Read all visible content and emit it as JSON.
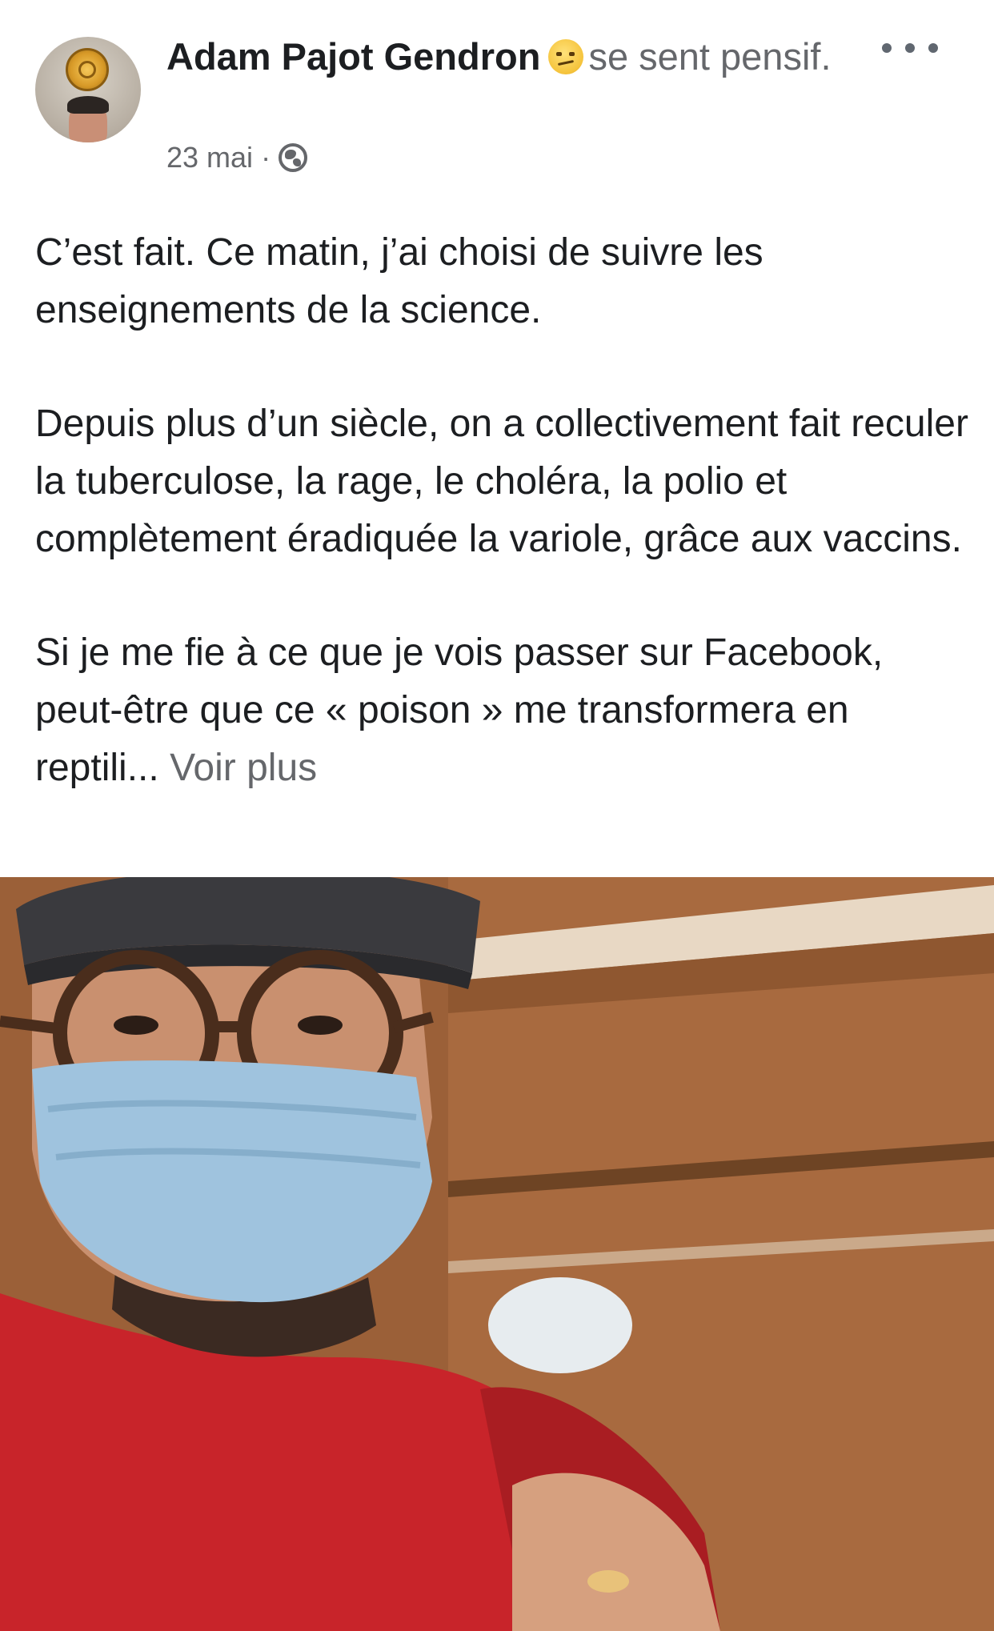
{
  "post": {
    "author": {
      "name": "Adam Pajot Gendron",
      "feeling_emoji": "pensive-face-icon",
      "feeling_text": "se sent pensif."
    },
    "meta": {
      "date": "23 mai",
      "separator": "·",
      "privacy_icon": "globe-icon"
    },
    "menu_icon": "more-options-icon",
    "paragraphs": [
      "C’est fait.  Ce matin, j’ai choisi de suivre les enseignements de la science.",
      "Depuis plus d’un siècle, on a collectivement fait reculer la tuberculose, la rage, le choléra, la polio et complètement éradiquée la variole, grâce aux vaccins.",
      "Si je me fie à ce que je vois passer sur Facebook, peut-être que ce « poison » me transformera en reptili..."
    ],
    "see_more": "Voir plus",
    "colors": {
      "text": "#1c1e21",
      "secondary_text": "#65676b",
      "background": "#ffffff"
    }
  }
}
